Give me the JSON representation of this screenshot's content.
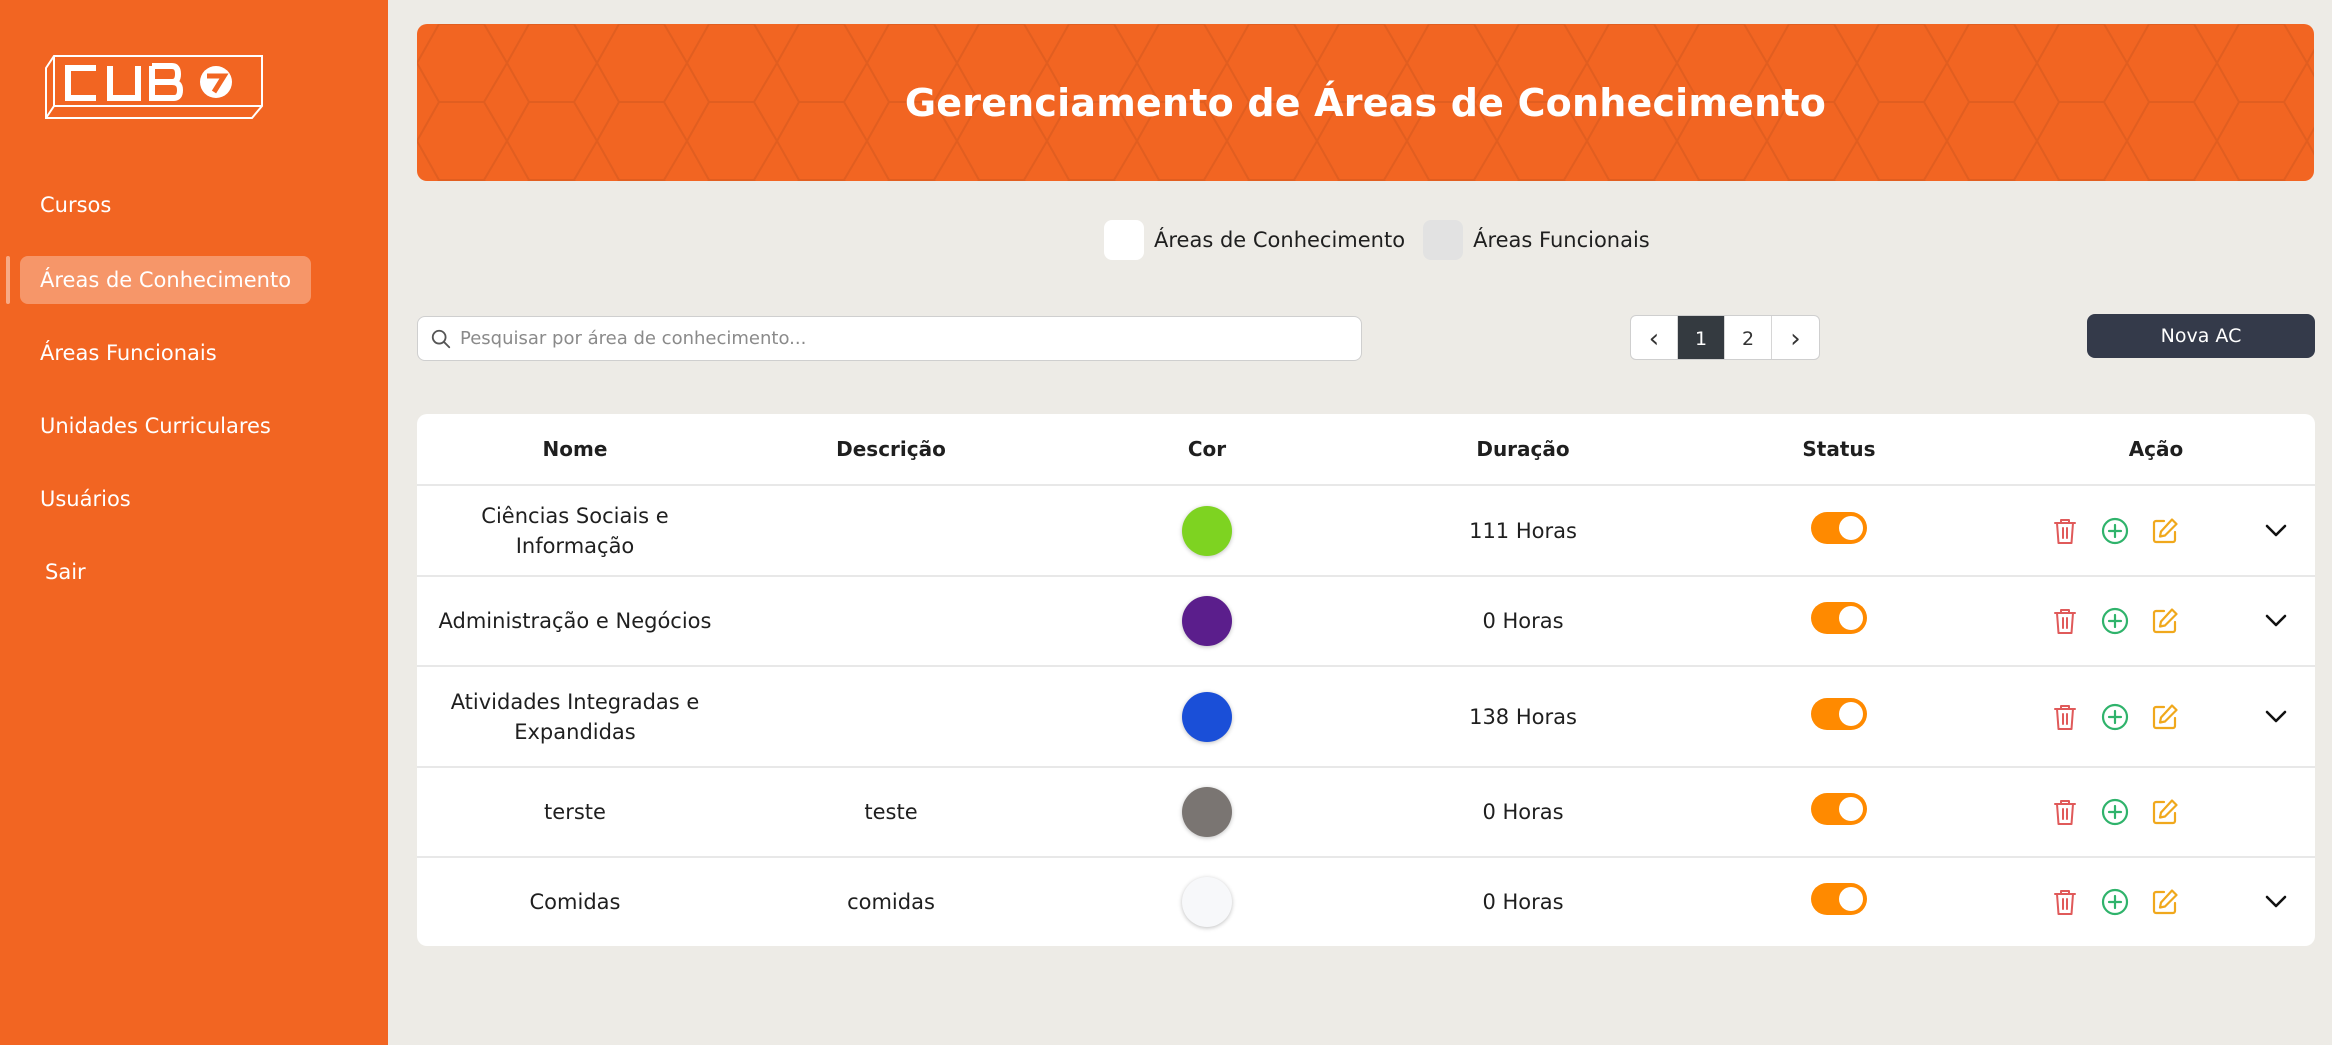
{
  "logo": {
    "text": "CUBO"
  },
  "sidebar": {
    "items": [
      {
        "label": "Cursos"
      },
      {
        "label": "Áreas de Conhecimento"
      },
      {
        "label": "Áreas Funcionais"
      },
      {
        "label": "Unidades Curriculares"
      },
      {
        "label": "Usuários"
      },
      {
        "label": "Sair"
      }
    ]
  },
  "header": {
    "title": "Gerenciamento de Áreas de Conhecimento"
  },
  "legend": {
    "items": [
      {
        "label": "Áreas de Conhecimento",
        "color": "#ffffff"
      },
      {
        "label": "Áreas Funcionais",
        "color": "#e2e2e2"
      }
    ]
  },
  "search": {
    "placeholder": "Pesquisar por área de conhecimento...",
    "value": ""
  },
  "pagination": {
    "prev": "‹",
    "pages": [
      "1",
      "2"
    ],
    "current": "1",
    "next": "›"
  },
  "new_button": {
    "label": "Nova AC"
  },
  "table": {
    "headers": [
      "Nome",
      "Descrição",
      "Cor",
      "Duração",
      "Status",
      "Ação"
    ],
    "rows": [
      {
        "nome": "Ciências Sociais e Informação",
        "descricao": "",
        "cor": "#7ed321",
        "duracao": "111 Horas",
        "status": true,
        "expandable": true
      },
      {
        "nome": "Administração e Negócios",
        "descricao": "",
        "cor": "#5b1e8c",
        "duracao": "0 Horas",
        "status": true,
        "expandable": true
      },
      {
        "nome": "Atividades Integradas e Expandidas",
        "descricao": "",
        "cor": "#1a4fd8",
        "duracao": "138 Horas",
        "status": true,
        "expandable": true
      },
      {
        "nome": "terste",
        "descricao": "teste",
        "cor": "#7a7572",
        "duracao": "0 Horas",
        "status": true,
        "expandable": false
      },
      {
        "nome": "Comidas",
        "descricao": "comidas",
        "cor": "#f7f8fa",
        "duracao": "0 Horas",
        "status": true,
        "expandable": true
      }
    ]
  },
  "colors": {
    "brand": "#f26522",
    "toggle_on": "#ff8a00",
    "delete": "#e05a5a",
    "add": "#2fb36b",
    "edit": "#f0a81c",
    "dark_button": "#343a4a"
  }
}
